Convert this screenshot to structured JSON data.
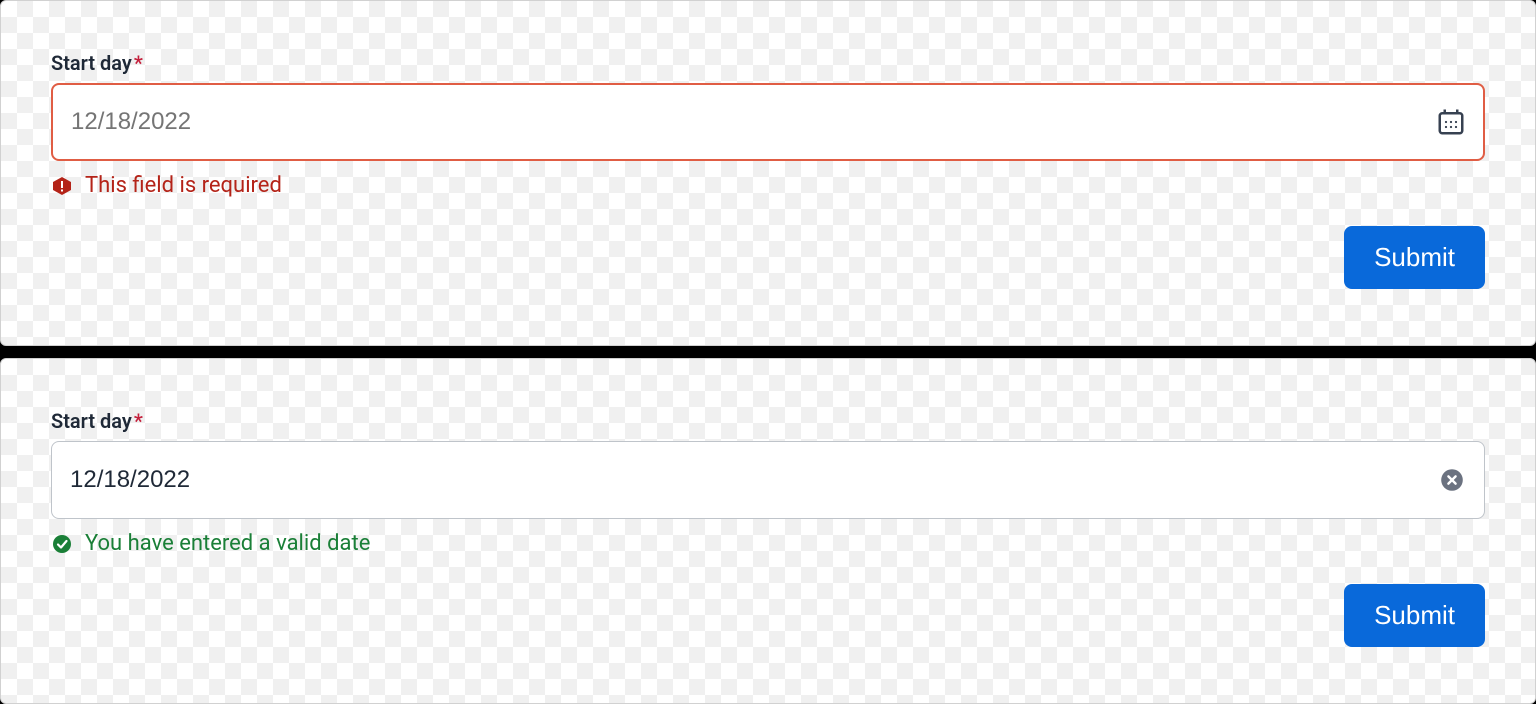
{
  "forms": [
    {
      "label": "Start day",
      "required_marker": "*",
      "placeholder": "12/18/2022",
      "value": "",
      "state": "error",
      "right_icon": "calendar-icon",
      "message": "This field is required",
      "message_icon": "warning-icon",
      "submit_label": "Submit"
    },
    {
      "label": "Start day",
      "required_marker": "*",
      "placeholder": "",
      "value": "12/18/2022",
      "state": "valid",
      "right_icon": "clear-icon",
      "message": "You have entered a valid date",
      "message_icon": "check-icon",
      "submit_label": "Submit"
    }
  ],
  "colors": {
    "error_border": "#e05d44",
    "error_text": "#b42318",
    "success_text": "#1a7f37",
    "primary": "#0969da",
    "icon_dark": "#374151",
    "icon_grey": "#6b7280"
  }
}
